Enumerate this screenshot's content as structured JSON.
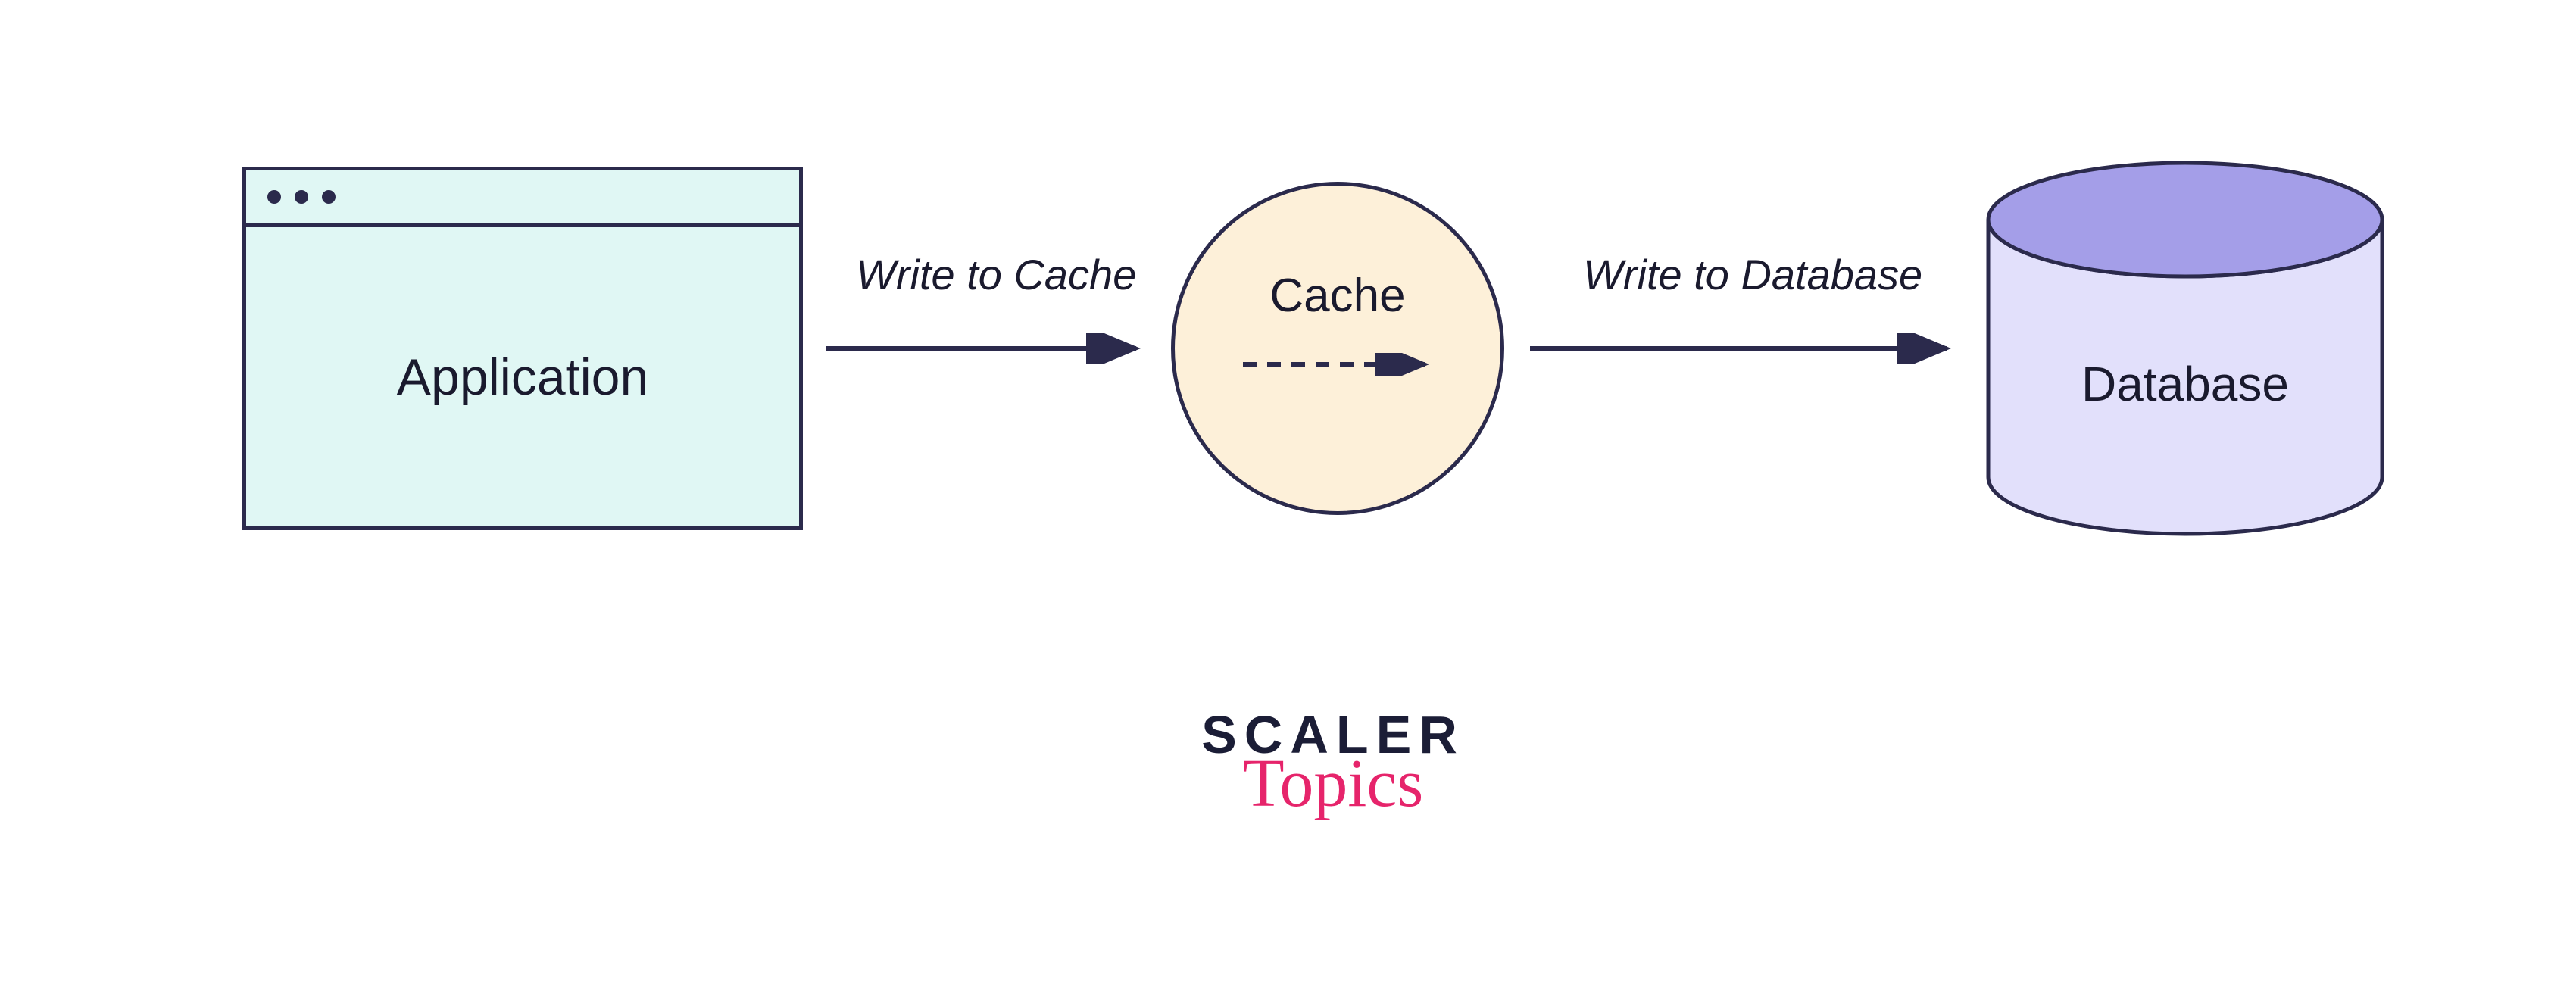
{
  "nodes": {
    "application": {
      "label": "Application"
    },
    "cache": {
      "label": "Cache"
    },
    "database": {
      "label": "Database"
    }
  },
  "edges": {
    "app_to_cache": {
      "label": "Write to Cache"
    },
    "cache_to_db": {
      "label": "Write to Database"
    }
  },
  "logo": {
    "line1": "SCALER",
    "line2": "Topics"
  },
  "colors": {
    "stroke": "#2b2a4c",
    "app_fill": "#e0f7f4",
    "cache_fill": "#fdf0d9",
    "db_side": "#e2e0fb",
    "db_top": "#a49ee8",
    "logo_accent": "#e6246b"
  }
}
